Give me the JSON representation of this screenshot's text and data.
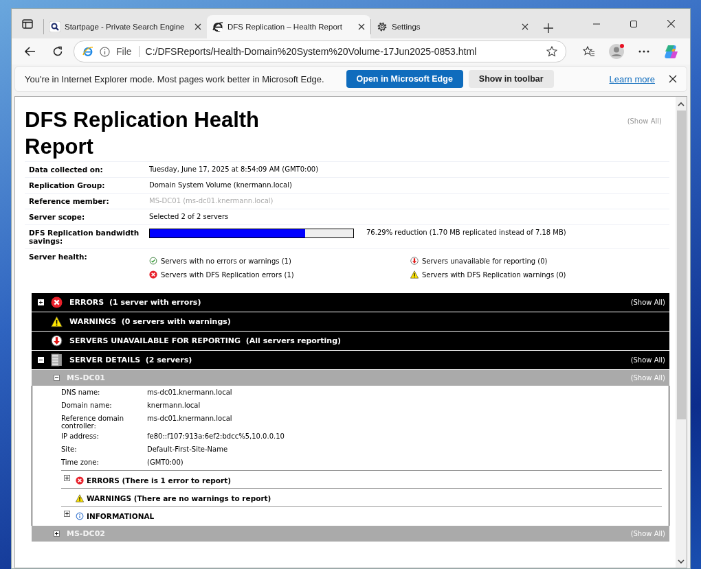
{
  "browser": {
    "tabs": [
      {
        "title": "Startpage - Private Search Engine",
        "kind": "search",
        "selected": false
      },
      {
        "title": "DFS Replication – Health Report",
        "kind": "ie",
        "selected": true
      },
      {
        "title": "Settings",
        "kind": "gear",
        "selected": false
      }
    ],
    "address": {
      "scheme": "File",
      "url": "C:/DFSReports/Health-Domain%20System%20Volume-17Jun2025-0853.html"
    }
  },
  "infobar": {
    "message": "You're in Internet Explorer mode. Most pages work better in Microsoft Edge.",
    "primary_button": "Open in Microsoft Edge",
    "secondary_button": "Show in toolbar",
    "link": "Learn more"
  },
  "report": {
    "title": "DFS Replication Health Report",
    "show_all": "(Show All)",
    "summary": [
      {
        "label": "Data collected on:",
        "kind": "text",
        "value": "Tuesday, June 17, 2025 at 8:54:09 AM (GMT0:00)"
      },
      {
        "label": "Replication Group:",
        "kind": "text",
        "value": "Domain System Volume (knermann.local)"
      },
      {
        "label": "Reference member:",
        "kind": "muted",
        "value": "MS-DC01 (ms-dc01.knermann.local)"
      },
      {
        "label": "Server scope:",
        "kind": "text",
        "value": "Selected 2 of 2 servers"
      },
      {
        "label": "DFS Replication bandwidth savings:",
        "kind": "bar",
        "level": 0.7629,
        "value": "76.29% reduction (1.70 MB replicated instead of 7.18 MB)"
      }
    ],
    "health_label": "Server health:",
    "health": [
      {
        "kind": "ok",
        "text": "Servers with no errors or warnings (1)"
      },
      {
        "kind": "down",
        "text": "Servers unavailable for reporting (0)"
      },
      {
        "kind": "error",
        "text": "Servers with DFS Replication errors (1)"
      },
      {
        "kind": "warning",
        "text": "Servers with DFS Replication warnings (0)"
      }
    ],
    "sections": [
      {
        "kind": "error",
        "title": "ERRORS",
        "detail": "(1 server with errors)",
        "expanded": false,
        "show_all": "(Show All)"
      },
      {
        "kind": "warning",
        "title": "WARNINGS",
        "detail": "(0 servers with warnings)"
      },
      {
        "kind": "down",
        "title": "SERVERS UNAVAILABLE FOR REPORTING",
        "detail": "(All servers reporting)"
      },
      {
        "kind": "server",
        "title": "SERVER DETAILS",
        "detail": "(2 servers)",
        "expanded": true,
        "show_all": "(Show All)"
      }
    ],
    "servers": [
      {
        "name": "MS-DC01",
        "expanded": true,
        "show_all": "(Show All)",
        "fields": [
          {
            "label": "DNS name:",
            "value": "ms-dc01.knermann.local"
          },
          {
            "label": "Domain name:",
            "value": "knermann.local"
          },
          {
            "label": "Reference domain controller:",
            "value": "ms-dc01.knermann.local"
          },
          {
            "label": "IP address:",
            "value": "fe80::f107:913a:6ef2:bdcc%5,10.0.0.10"
          },
          {
            "label": "Site:",
            "value": "Default-First-Site-Name"
          },
          {
            "label": "Time zone:",
            "value": "(GMT0:00)"
          }
        ],
        "subsections": [
          {
            "kind": "error",
            "text": "ERRORS (There is 1 error to report)",
            "expanded": false
          },
          {
            "kind": "warning",
            "text": "WARNINGS (There are no warnings to report)"
          },
          {
            "kind": "info",
            "text": "INFORMATIONAL",
            "expanded": false
          }
        ]
      },
      {
        "name": "MS-DC02",
        "expanded": false,
        "show_all": "(Show All)"
      }
    ]
  }
}
